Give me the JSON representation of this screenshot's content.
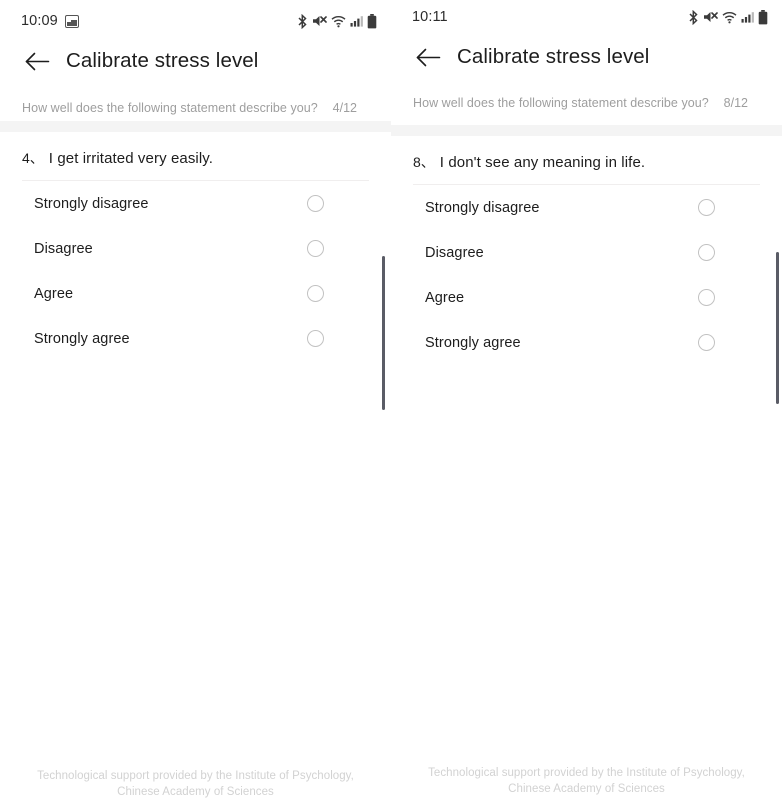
{
  "panels": [
    {
      "status": {
        "time": "10:09",
        "show_image_notification": true,
        "image_notification_icon": "image-icon",
        "icons": [
          "bluetooth-icon",
          "volume-muted-icon",
          "wifi-icon",
          "cellular-signal-icon",
          "battery-icon"
        ]
      },
      "appbar": {
        "back_icon": "back-arrow-icon",
        "title": "Calibrate stress level"
      },
      "progress": {
        "prompt": "How well does the following statement describe you?",
        "count": "4/12"
      },
      "question": {
        "number": "4、",
        "text": "I get irritated very easily."
      },
      "options": [
        {
          "label": "Strongly disagree",
          "selected": false
        },
        {
          "label": "Disagree",
          "selected": false
        },
        {
          "label": "Agree",
          "selected": false
        },
        {
          "label": "Strongly agree",
          "selected": false
        }
      ],
      "footer": "Technological support provided by the Institute of Psychology, Chinese Academy of Sciences"
    },
    {
      "status": {
        "time": "10:11",
        "show_image_notification": false,
        "image_notification_icon": "image-icon",
        "icons": [
          "bluetooth-icon",
          "volume-muted-icon",
          "wifi-icon",
          "cellular-signal-icon",
          "battery-icon"
        ]
      },
      "appbar": {
        "back_icon": "back-arrow-icon",
        "title": "Calibrate stress level"
      },
      "progress": {
        "prompt": "How well does the following statement describe you?",
        "count": "8/12"
      },
      "question": {
        "number": "8、",
        "text": "I don't see any meaning in life."
      },
      "options": [
        {
          "label": "Strongly disagree",
          "selected": false
        },
        {
          "label": "Disagree",
          "selected": false
        },
        {
          "label": "Agree",
          "selected": false
        },
        {
          "label": "Strongly agree",
          "selected": false
        }
      ],
      "footer": "Technological support provided by the Institute of Psychology, Chinese Academy of Sciences"
    }
  ],
  "colors": {
    "background": "#ffffff",
    "band": "#f4f4f4",
    "text_primary": "#1d1d1d",
    "text_muted": "#9e9e9e",
    "footer_text": "#d2d2d2",
    "radio_border": "#c2c2c2",
    "scrollbar": "#5a5c66"
  }
}
